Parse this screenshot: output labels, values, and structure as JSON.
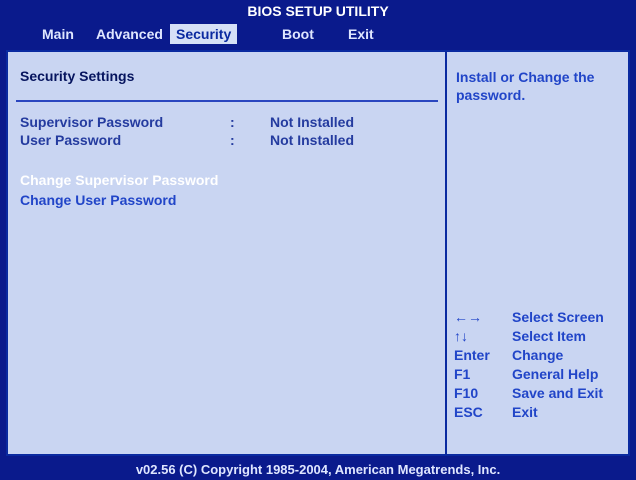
{
  "window": {
    "title": "BIOS SETUP UTILITY"
  },
  "menu": {
    "tabs": [
      {
        "label": "Main"
      },
      {
        "label": "Advanced"
      },
      {
        "label": "Security"
      },
      {
        "label": "Boot"
      },
      {
        "label": "Exit"
      }
    ],
    "active": "Security"
  },
  "main": {
    "section_title": "Security Settings",
    "rows": [
      {
        "label": "Supervisor Password",
        "colon": ":",
        "value": "Not Installed"
      },
      {
        "label": "User Password",
        "colon": ":",
        "value": "Not Installed"
      }
    ],
    "links": [
      {
        "label": "Change Supervisor Password"
      },
      {
        "label": "Change User Password"
      }
    ]
  },
  "help": {
    "text": "Install or Change the password.",
    "keys": [
      {
        "key": "←→",
        "desc": "Select Screen"
      },
      {
        "key": "↑↓",
        "desc": "Select Item"
      },
      {
        "key": "Enter",
        "desc": "Change"
      },
      {
        "key": "F1",
        "desc": "General Help"
      },
      {
        "key": "F10",
        "desc": "Save and Exit"
      },
      {
        "key": "ESC",
        "desc": "Exit"
      }
    ]
  },
  "footer": {
    "text": "v02.56 (C) Copyright 1985-2004, American Megatrends, Inc."
  },
  "colors": {
    "background": "#0a1a8c",
    "panel": "#c9d5f2",
    "selected_link": "#ffffff",
    "link": "#2145c8",
    "text": "#243b9f"
  }
}
